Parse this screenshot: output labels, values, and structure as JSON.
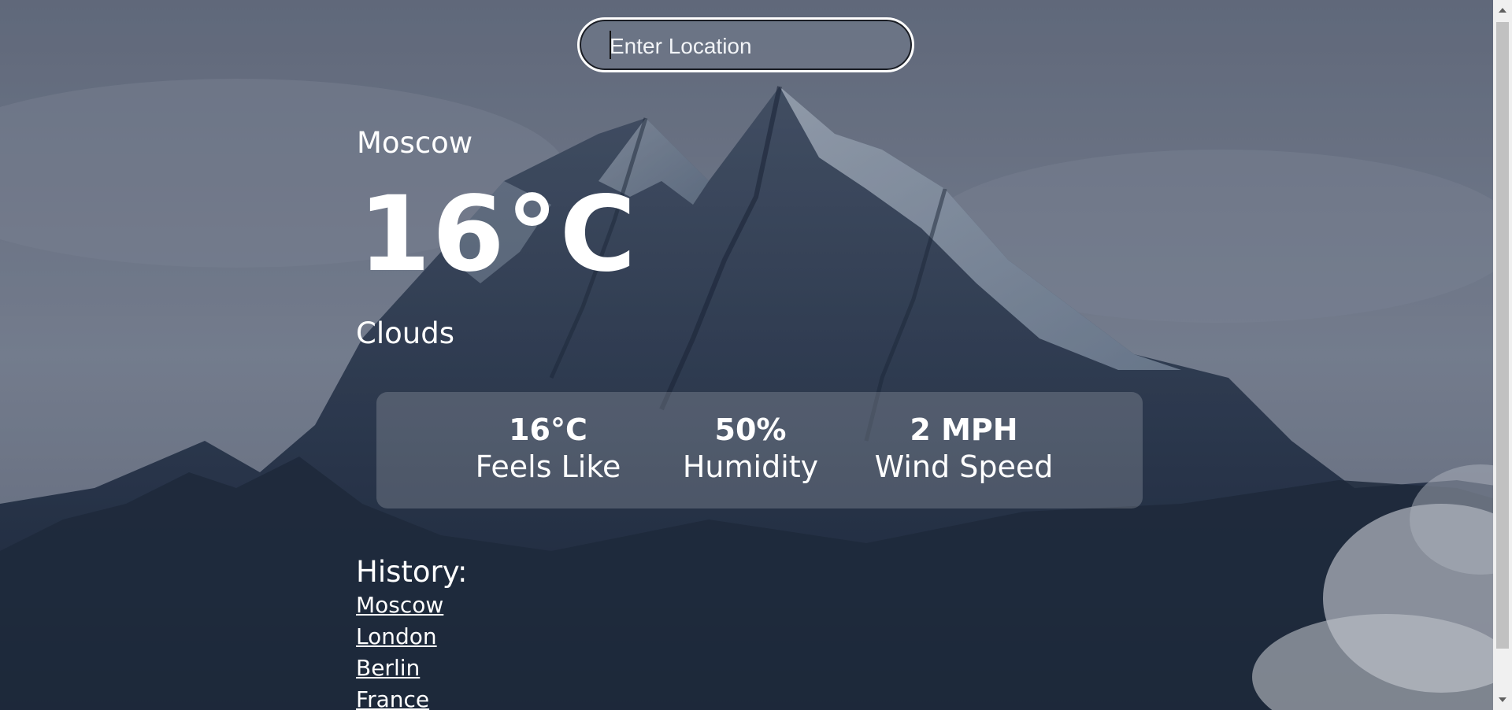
{
  "search": {
    "placeholder": "Enter Location",
    "value": ""
  },
  "weather": {
    "city": "Moscow",
    "temperature": "16°C",
    "description": "Clouds"
  },
  "stats": {
    "feels_like": {
      "value": "16°C",
      "label": "Feels Like"
    },
    "humidity": {
      "value": "50%",
      "label": "Humidity"
    },
    "wind": {
      "value": "2 MPH",
      "label": "Wind Speed"
    }
  },
  "history": {
    "title": "History:",
    "items": [
      "Moscow",
      "London",
      "Berlin",
      "France"
    ]
  },
  "background": {
    "image": "snowy-mountain-peak",
    "sky_color": "#7a8494",
    "rock_color": "#3b4a5e",
    "shadow_color": "#1f2b3c"
  }
}
